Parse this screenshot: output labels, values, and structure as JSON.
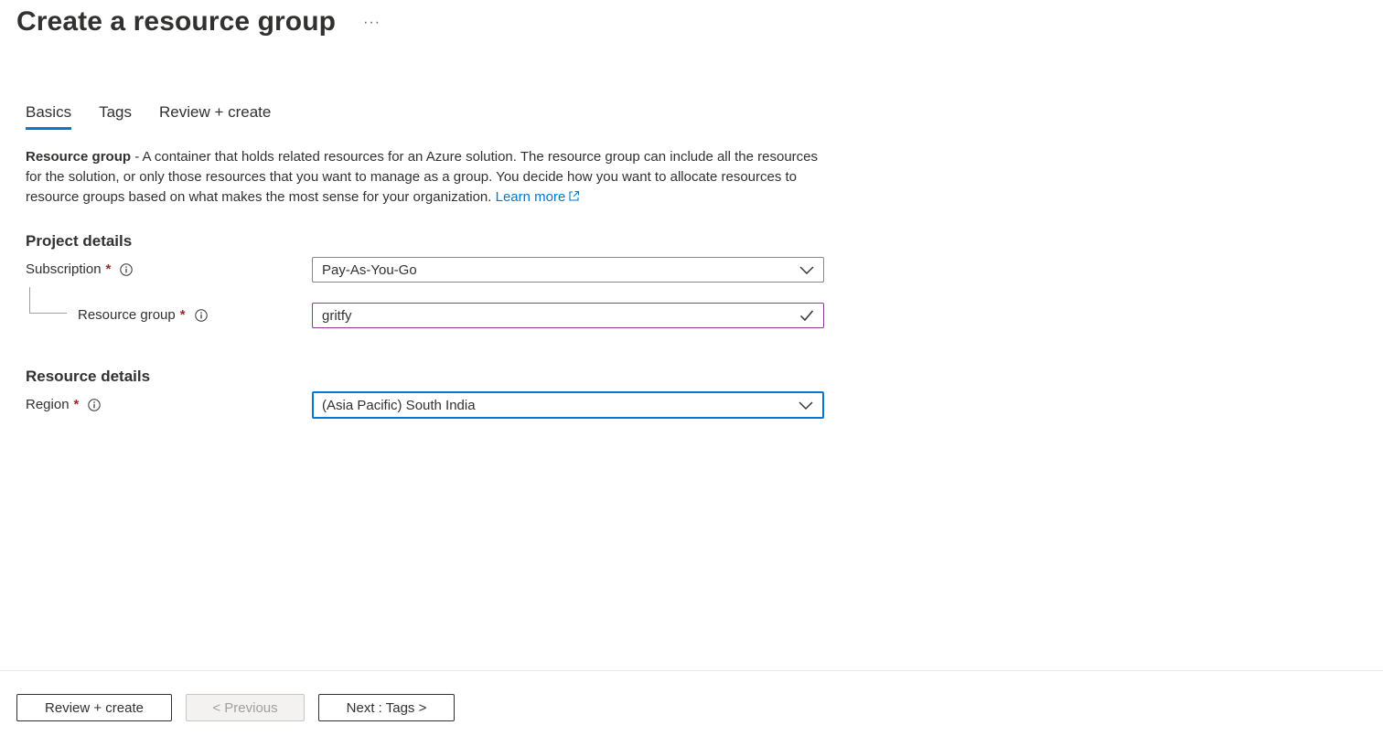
{
  "header": {
    "title": "Create a resource group",
    "more_label": "···"
  },
  "tabs": [
    {
      "label": "Basics",
      "active": true
    },
    {
      "label": "Tags",
      "active": false
    },
    {
      "label": "Review + create",
      "active": false
    }
  ],
  "description": {
    "bold_term": "Resource group",
    "text": " - A container that holds related resources for an Azure solution. The resource group can include all the resources for the solution, or only those resources that you want to manage as a group. You decide how you want to allocate resources to resource groups based on what makes the most sense for your organization. ",
    "link_label": "Learn more"
  },
  "project_details": {
    "title": "Project details",
    "subscription": {
      "label": "Subscription",
      "value": "Pay-As-You-Go"
    },
    "resource_group": {
      "label": "Resource group",
      "value": "gritfy"
    }
  },
  "resource_details": {
    "title": "Resource details",
    "region": {
      "label": "Region",
      "value": "(Asia Pacific) South India"
    }
  },
  "required_marker": "*",
  "footer": {
    "review_create_label": "Review + create",
    "previous_label": "< Previous",
    "next_label": "Next : Tags >"
  },
  "colors": {
    "accent": "#0078d4",
    "required": "#a4262c",
    "validated_border": "#8a3b8f"
  }
}
